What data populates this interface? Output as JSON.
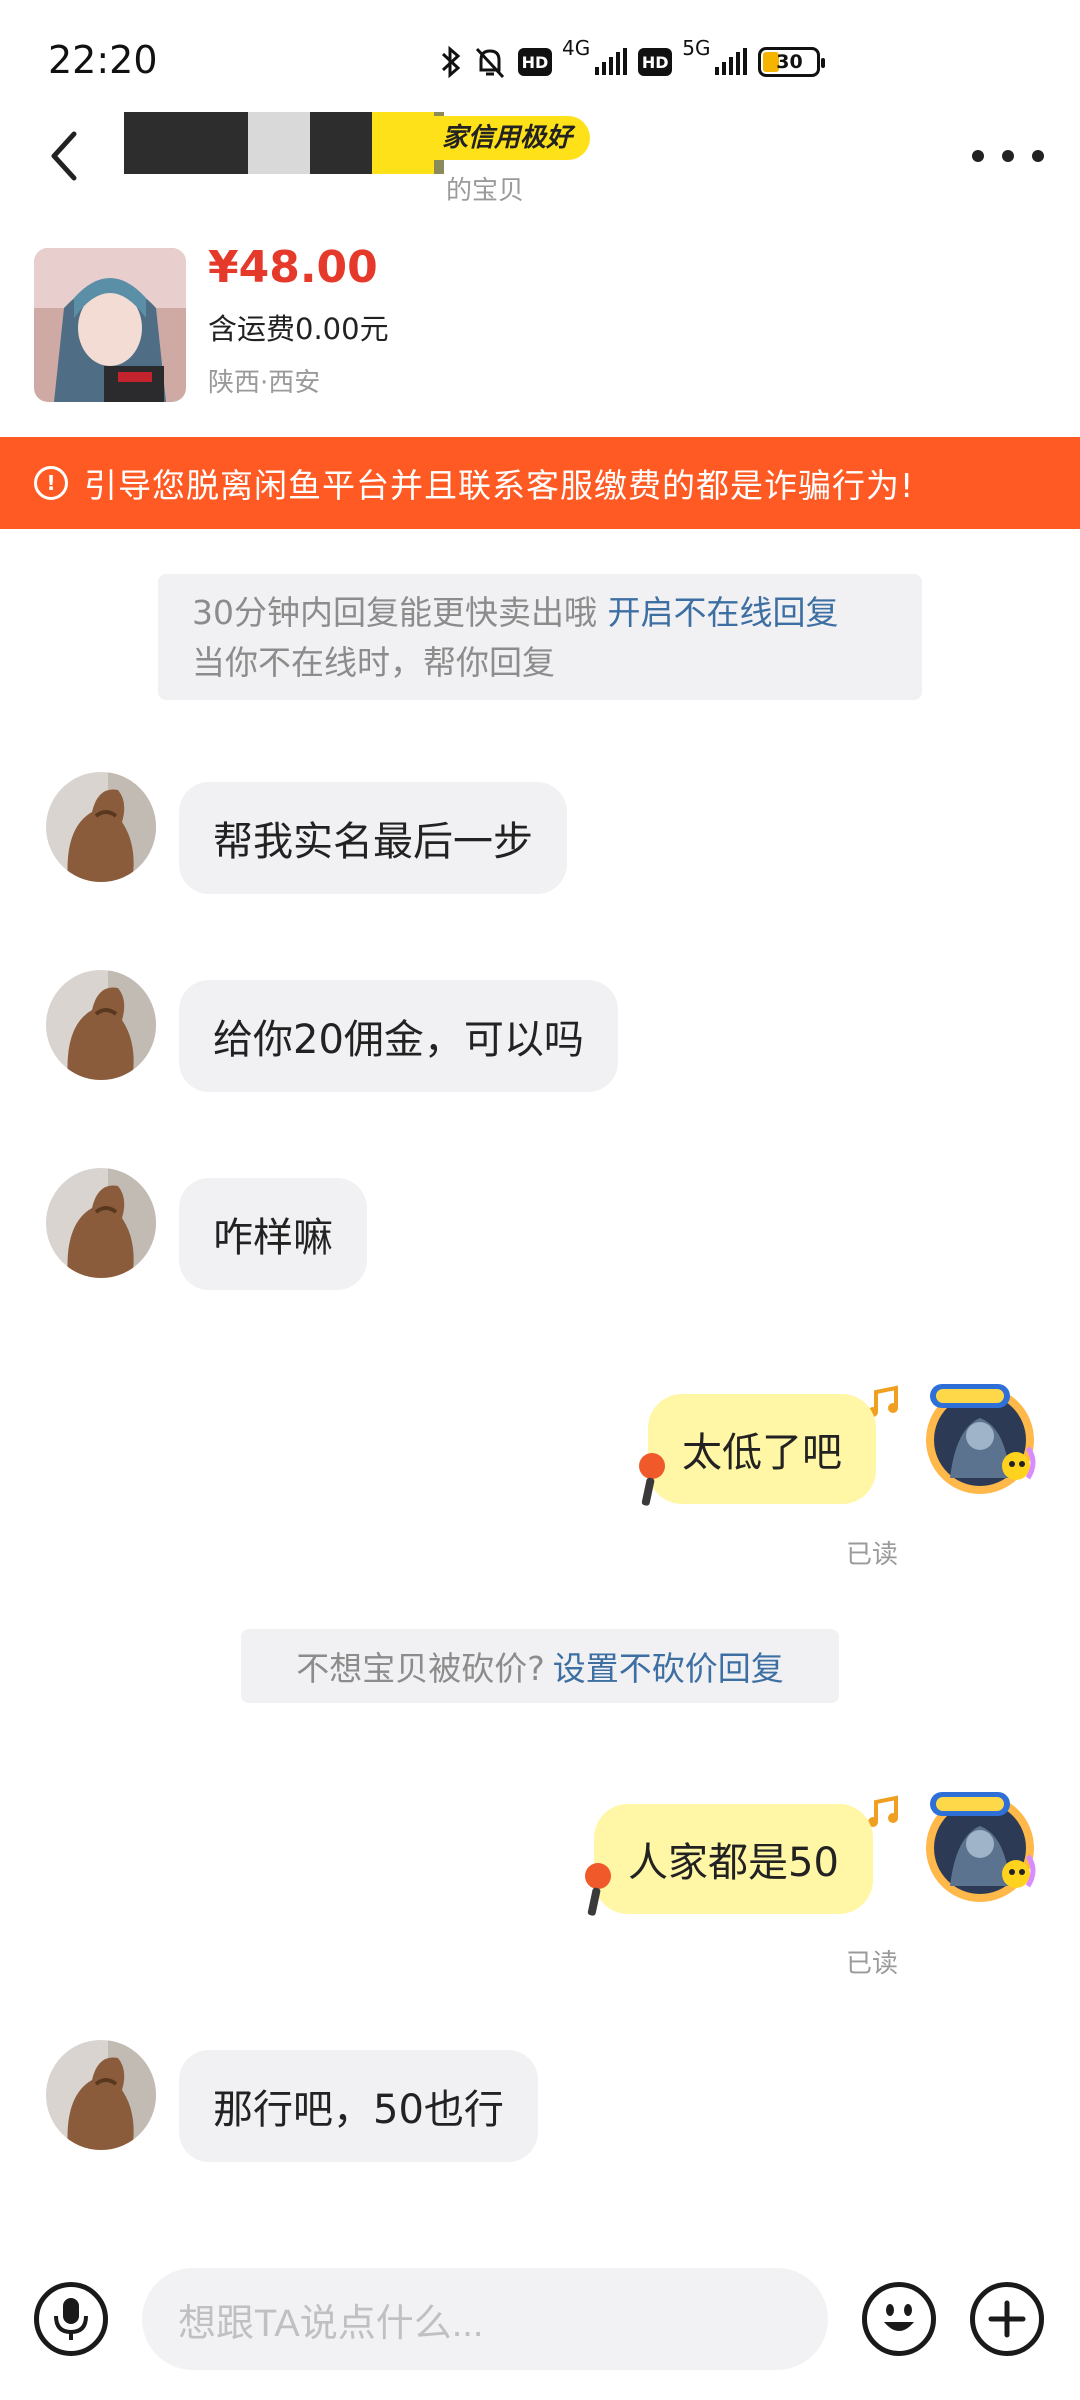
{
  "status_bar": {
    "time": "22:20",
    "net1": "4G",
    "net2": "5G",
    "hd": "HD",
    "battery": "30"
  },
  "header": {
    "credit_badge": "家信用极好",
    "seller_sub": "的宝贝"
  },
  "product": {
    "price": "¥48.00",
    "shipping": "含运费0.00元",
    "location": "陕西·西安"
  },
  "warning": {
    "text": "引导您脱离闲鱼平台并且联系客服缴费的都是诈骗行为!"
  },
  "tips": {
    "reply_tip_text": "30分钟内回复能更快卖出哦",
    "reply_tip_link": "开启不在线回复",
    "reply_tip_line2": "当你不在线时，帮你回复",
    "bargain_tip_text": "不想宝贝被砍价?",
    "bargain_tip_link": "设置不砍价回复"
  },
  "messages": [
    {
      "side": "left",
      "text": "帮我实名最后一步"
    },
    {
      "side": "left",
      "text": "给你20佣金，可以吗"
    },
    {
      "side": "left",
      "text": "咋样嘛"
    },
    {
      "side": "right",
      "text": "太低了吧",
      "status": "已读"
    },
    {
      "side": "right",
      "text": "人家都是50",
      "status": "已读"
    },
    {
      "side": "left",
      "text": "那行吧，50也行"
    }
  ],
  "input": {
    "placeholder": "想跟TA说点什么..."
  }
}
